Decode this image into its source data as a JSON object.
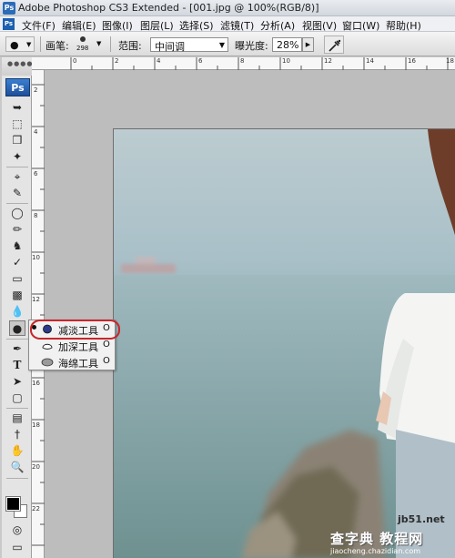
{
  "window": {
    "title": "Adobe Photoshop CS3 Extended - [001.jpg @ 100%(RGB/8)]",
    "app_icon": "Ps"
  },
  "menubar": {
    "logo": "Ps",
    "items": [
      "文件(F)",
      "编辑(E)",
      "图像(I)",
      "图层(L)",
      "选择(S)",
      "滤镜(T)",
      "分析(A)",
      "视图(V)",
      "窗口(W)",
      "帮助(H)"
    ]
  },
  "options": {
    "brush_label": "画笔:",
    "brush_size": "298",
    "range_label": "范围:",
    "range_value": "中间调",
    "exposure_label": "曝光度:",
    "exposure_value": "28%"
  },
  "toolbox": {
    "logo": "Ps",
    "active_tool": "dodge-tool"
  },
  "rulers": {
    "top": [
      "0",
      "2",
      "4",
      "6",
      "8",
      "10",
      "12",
      "14",
      "16",
      "18"
    ],
    "left": [
      "2",
      "4",
      "6",
      "8",
      "10",
      "12",
      "14",
      "16",
      "18",
      "20",
      "22"
    ]
  },
  "flyout": {
    "items": [
      {
        "label": "减淡工具",
        "shortcut": "O",
        "icon": "dodge-icon",
        "selected": true
      },
      {
        "label": "加深工具",
        "shortcut": "O",
        "icon": "burn-icon",
        "selected": false
      },
      {
        "label": "海绵工具",
        "shortcut": "O",
        "icon": "sponge-icon",
        "selected": false
      }
    ]
  },
  "watermark": {
    "site": "jb51.net",
    "main": "查字典 教程网",
    "url": "jiaocheng.chazidian.com"
  },
  "colors": {
    "highlight_ring": "#c8262a",
    "foreground": "#000000",
    "background": "#ffffff"
  }
}
